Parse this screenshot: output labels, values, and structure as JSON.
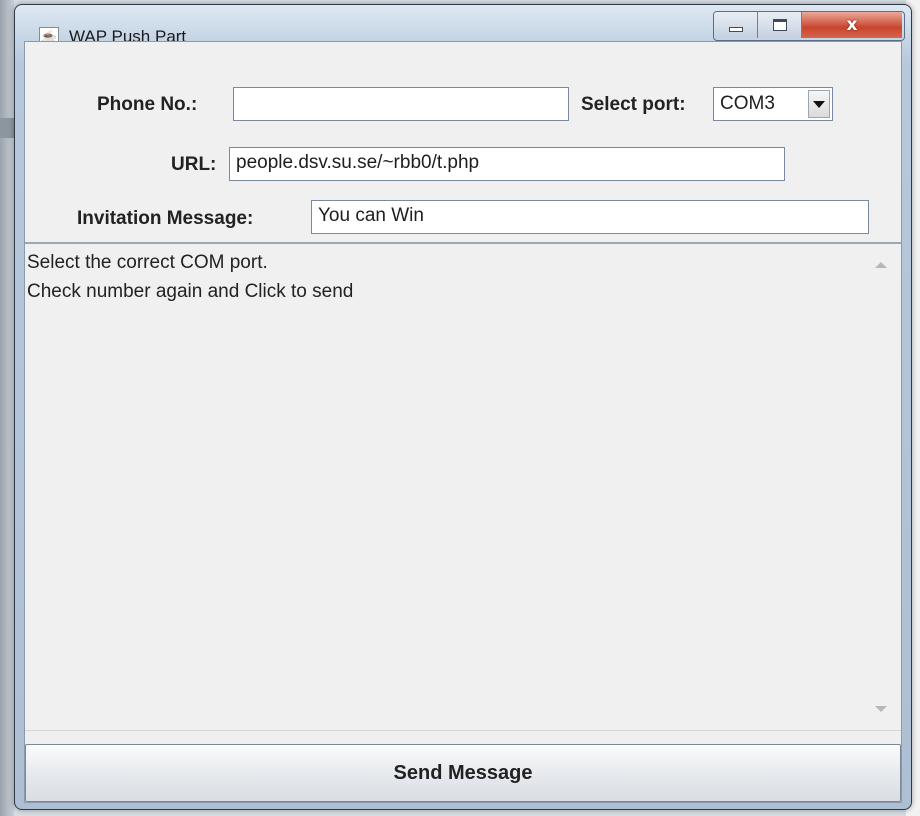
{
  "window": {
    "title": "WAP Push Part",
    "icon": "java-cup-icon",
    "controls": [
      "minimize-icon",
      "maximize-icon",
      "close-icon"
    ],
    "close_glyph": "x"
  },
  "form": {
    "phone_label": "Phone No.:",
    "phone_value": "",
    "port_label": "Select port:",
    "port_value": "COM3",
    "url_label": "URL:",
    "url_value": "people.dsv.su.se/~rbb0/t.php",
    "invitation_label": "Invitation Message:",
    "invitation_value": "You can Win"
  },
  "output": {
    "lines": [
      "Select the correct COM port.",
      "Check number again and Click to send"
    ]
  },
  "send_label": "Send Message",
  "colors": {
    "client_bg": "#f0f0f0",
    "close_button": "#c8452c",
    "frame": "#b7c8dc"
  }
}
